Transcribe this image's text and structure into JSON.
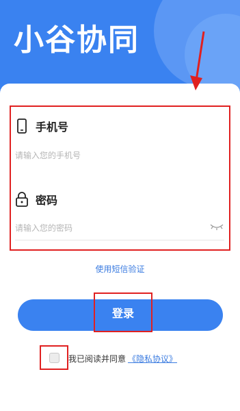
{
  "app": {
    "title": "小谷协同"
  },
  "phone": {
    "label": "手机号",
    "placeholder": "请输入您的手机号",
    "icon": "phone-icon"
  },
  "password": {
    "label": "密码",
    "placeholder": "请输入您的密码",
    "icon": "lock-icon",
    "toggle_icon": "eye-closed-icon"
  },
  "sms_login_link": "使用短信验证",
  "login_button": "登录",
  "agreement": {
    "text": "我已阅读并同意",
    "link": "《隐私协议》",
    "checked": false
  },
  "colors": {
    "primary": "#3a82f0",
    "link": "#3a7be0",
    "highlight": "#e02020"
  }
}
